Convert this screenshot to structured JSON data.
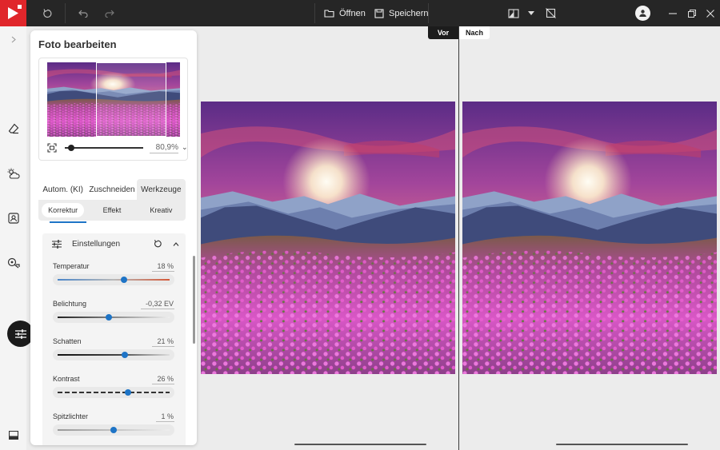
{
  "app": {
    "accent": "#1e74c6",
    "logo_color": "#e0262b"
  },
  "toolbar": {
    "open_label": "Öffnen",
    "save_label": "Speichern"
  },
  "panel": {
    "title": "Foto bearbeiten",
    "zoom_value": "80,9%",
    "tabs": [
      {
        "label": "Autom. (KI)"
      },
      {
        "label": "Zuschneiden"
      },
      {
        "label": "Werkzeuge"
      }
    ],
    "subtabs": [
      {
        "label": "Korrektur"
      },
      {
        "label": "Effekt"
      },
      {
        "label": "Kreativ"
      }
    ],
    "settings_label": "Einstellungen",
    "adjustments": [
      {
        "name": "Temperatur",
        "value": "18 %",
        "level": 0.59
      },
      {
        "name": "Belichtung",
        "value": "-0,32 EV",
        "level": 0.46
      },
      {
        "name": "Schatten",
        "value": "21 %",
        "level": 0.6
      },
      {
        "name": "Kontrast",
        "value": "26 %",
        "level": 0.63
      },
      {
        "name": "Spitzlichter",
        "value": "1 %",
        "level": 0.5
      }
    ]
  },
  "compare": {
    "before_label": "Vor",
    "after_label": "Nach"
  }
}
